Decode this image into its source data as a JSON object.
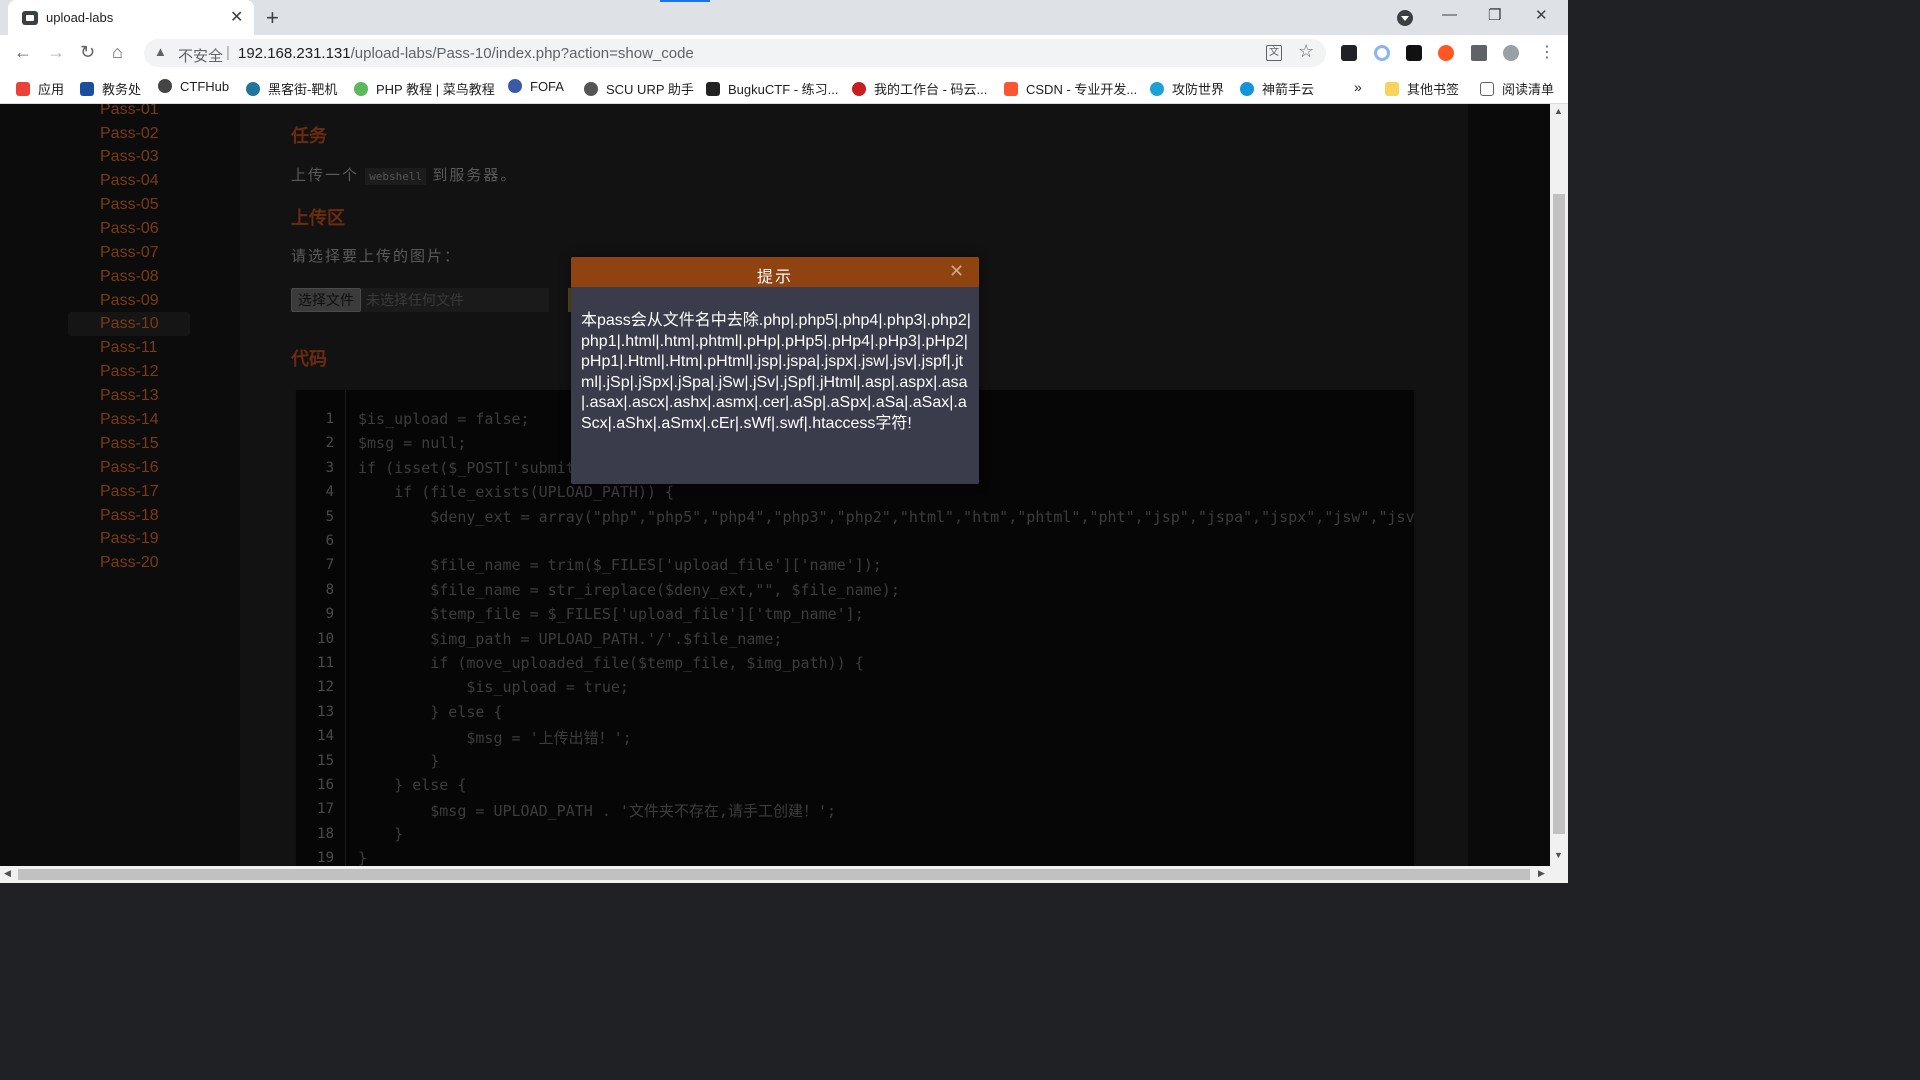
{
  "browser": {
    "tab_title": "upload-labs",
    "tab_close": "✕",
    "new_tab": "+",
    "security_label": "不安全",
    "url_host": "192.168.231.131",
    "url_path": "/upload-labs/Pass-10/index.php?action=show_code",
    "window_controls": [
      "—",
      "❐",
      "✕"
    ],
    "extensions": [
      "tampermonkey-icon",
      "circle-ext-icon",
      "h-ext-icon",
      "infinity-ext-icon",
      "puzzle-icon",
      "profile-icon",
      "menu-icon"
    ]
  },
  "bookmarks": [
    {
      "label": "应用",
      "icon": "apps-grid-icon",
      "color": "#ea4335"
    },
    {
      "label": "教务处",
      "icon": "urp-icon",
      "color": "#1a4fa0"
    },
    {
      "label": "CTFHub",
      "icon": "ctfhub-icon",
      "color": "#444444"
    },
    {
      "label": "黑客街-靶机",
      "icon": "wordpress-icon",
      "color": "#21759b"
    },
    {
      "label": "PHP 教程 | 菜鸟教程",
      "icon": "runoob-icon",
      "color": "#5cb85c"
    },
    {
      "label": "FOFA",
      "icon": "fofa-icon",
      "color": "#3a5aa8"
    },
    {
      "label": "SCU URP 助手",
      "icon": "scu-icon",
      "color": "#555555"
    },
    {
      "label": "BugkuCTF - 练习...",
      "icon": "bugku-icon",
      "color": "#222222"
    },
    {
      "label": "我的工作台 - 码云...",
      "icon": "gitee-icon",
      "color": "#c71d23"
    },
    {
      "label": "CSDN - 专业开发...",
      "icon": "csdn-icon",
      "color": "#fc5531"
    },
    {
      "label": "攻防世界",
      "icon": "adworld-icon",
      "color": "#1ea1d6"
    },
    {
      "label": "神箭手云",
      "icon": "shenjianshou-icon",
      "color": "#1296db"
    }
  ],
  "bookmarks_more": "»",
  "bookmarks_right": [
    {
      "label": "其他书签",
      "icon": "folder-icon",
      "color": "#f9d35c"
    },
    {
      "label": "阅读清单",
      "icon": "reading-list-icon",
      "color": "#5f6368"
    }
  ],
  "sidebar": {
    "items": [
      "Pass-01",
      "Pass-02",
      "Pass-03",
      "Pass-04",
      "Pass-05",
      "Pass-06",
      "Pass-07",
      "Pass-08",
      "Pass-09",
      "Pass-10",
      "Pass-11",
      "Pass-12",
      "Pass-13",
      "Pass-14",
      "Pass-15",
      "Pass-16",
      "Pass-17",
      "Pass-18",
      "Pass-19",
      "Pass-20"
    ],
    "active": "Pass-10"
  },
  "content": {
    "task_heading": "任务",
    "task_text_before": "上传一个",
    "task_code": "webshell",
    "task_text_after": "到服务器。",
    "upload_heading": "上传区",
    "upload_prompt": "请选择要上传的图片：",
    "file_button": "选择文件",
    "file_placeholder": "未选择任何文件",
    "code_heading": "代码"
  },
  "code_lines": [
    {
      "n": "1",
      "text": "$is_upload = false;"
    },
    {
      "n": "2",
      "text": "$msg = null;"
    },
    {
      "n": "3",
      "text": "if (isset($_POST['submit"
    },
    {
      "n": "4",
      "text": "    if (file_exists(UPLOAD_PATH)) {"
    },
    {
      "n": "5",
      "text": "        $deny_ext = array(\"php\",\"php5\",\"php4\",\"php3\",\"php2\",\"html\",\"htm\",\"phtml\",\"pht\",\"jsp\",\"jspa\",\"jspx\",\"jsw\",\"jsv\""
    },
    {
      "n": "6",
      "text": ""
    },
    {
      "n": "7",
      "text": "        $file_name = trim($_FILES['upload_file']['name']);"
    },
    {
      "n": "8",
      "text": "        $file_name = str_ireplace($deny_ext,\"\", $file_name);"
    },
    {
      "n": "9",
      "text": "        $temp_file = $_FILES['upload_file']['tmp_name'];"
    },
    {
      "n": "10",
      "text": "        $img_path = UPLOAD_PATH.'/'.$file_name;"
    },
    {
      "n": "11",
      "text": "        if (move_uploaded_file($temp_file, $img_path)) {"
    },
    {
      "n": "12",
      "text": "            $is_upload = true;"
    },
    {
      "n": "13",
      "text": "        } else {"
    },
    {
      "n": "14",
      "text": "            $msg = '上传出错！';"
    },
    {
      "n": "15",
      "text": "        }"
    },
    {
      "n": "16",
      "text": "    } else {"
    },
    {
      "n": "17",
      "text": "        $msg = UPLOAD_PATH . '文件夹不存在,请手工创建！';"
    },
    {
      "n": "18",
      "text": "    }"
    },
    {
      "n": "19",
      "text": "}"
    }
  ],
  "dialog": {
    "title": "提示",
    "close": "✕",
    "message": "本pass会从文件名中去除.php|.php5|.php4|.php3|.php2|php1|.html|.htm|.phtml|.pHp|.pHp5|.pHp4|.pHp3|.pHp2|pHp1|.Html|.Htm|.pHtml|.jsp|.jspa|.jspx|.jsw|.jsv|.jspf|.jtml|.jSp|.jSpx|.jSpa|.jSw|.jSv|.jSpf|.jHtml|.asp|.aspx|.asa|.asax|.ascx|.ashx|.asmx|.cer|.aSp|.aSpx|.aSa|.aSax|.aScx|.aShx|.aSmx|.cEr|.sWf|.swf|.htaccess字符!"
  },
  "colors": {
    "accent": "#8f4310",
    "dialog_bg": "#3a3c4b",
    "sidebar_link": "#7a3a16"
  }
}
